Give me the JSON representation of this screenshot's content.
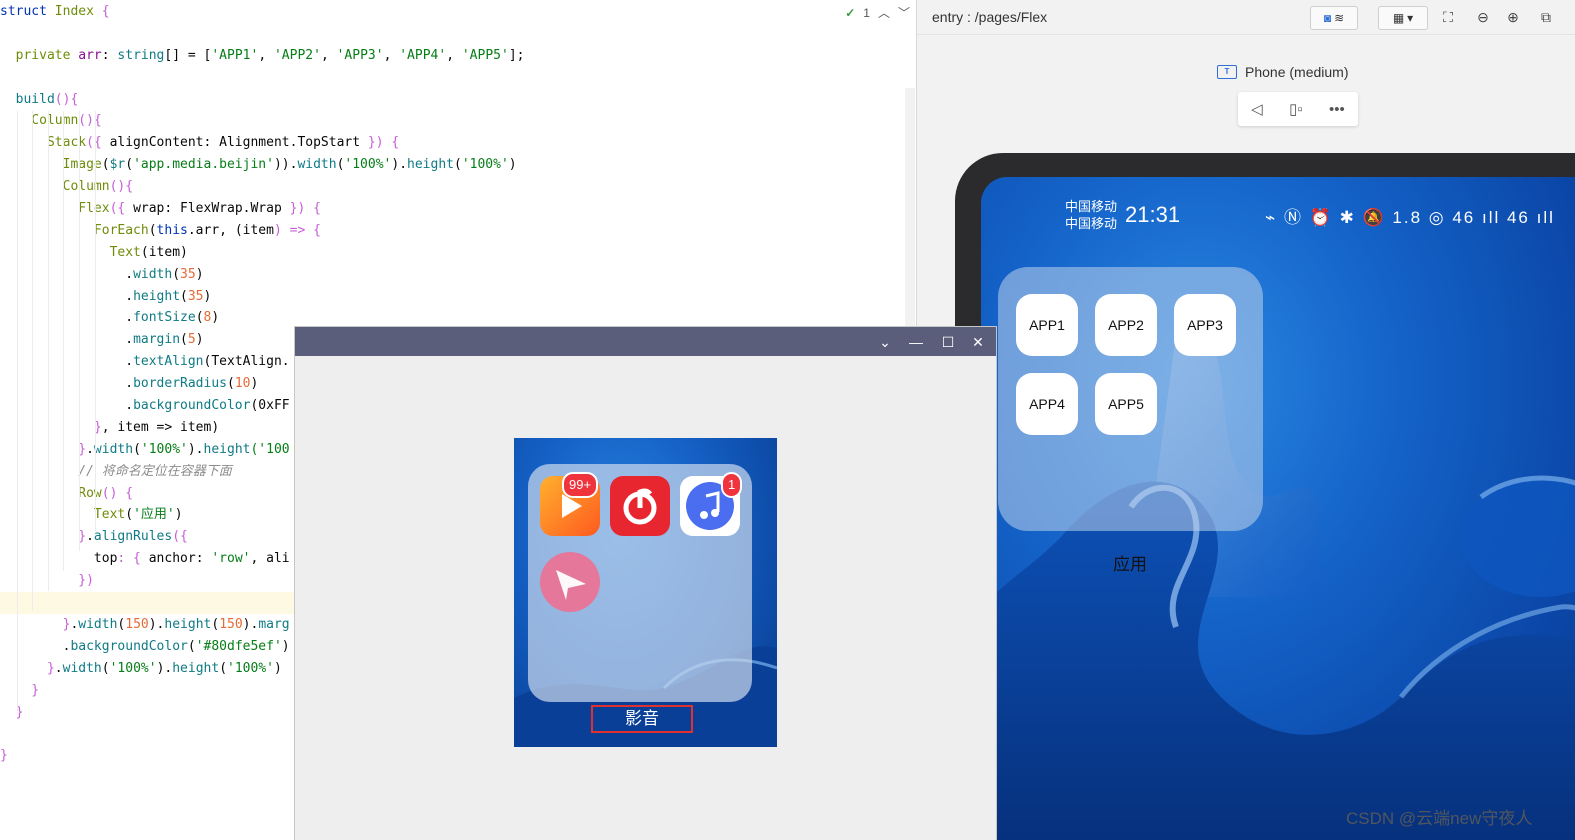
{
  "editor": {
    "inspection": {
      "count": "1"
    },
    "lines": [
      [
        {
          "t": "struct ",
          "c": "tok-kw"
        },
        {
          "t": "Index ",
          "c": "tok-olive"
        },
        {
          "t": "{",
          "c": "tok-brace"
        }
      ],
      [],
      [
        {
          "t": "  private ",
          "c": "tok-olive"
        },
        {
          "t": "arr",
          "c": "tok-prop"
        },
        {
          "t": ": ",
          "c": "tok-ident"
        },
        {
          "t": "string",
          "c": "tok-teal"
        },
        {
          "t": "[] = [",
          "c": "tok-ident"
        },
        {
          "t": "'APP1'",
          "c": "tok-str"
        },
        {
          "t": ", ",
          "c": "tok-ident"
        },
        {
          "t": "'APP2'",
          "c": "tok-str"
        },
        {
          "t": ", ",
          "c": "tok-ident"
        },
        {
          "t": "'APP3'",
          "c": "tok-str"
        },
        {
          "t": ", ",
          "c": "tok-ident"
        },
        {
          "t": "'APP4'",
          "c": "tok-str"
        },
        {
          "t": ", ",
          "c": "tok-ident"
        },
        {
          "t": "'APP5'",
          "c": "tok-str"
        },
        {
          "t": "];",
          "c": "tok-ident"
        }
      ],
      [],
      [
        {
          "t": "  build",
          "c": "tok-teal"
        },
        {
          "t": "(){",
          "c": "tok-brace"
        }
      ],
      [
        {
          "t": "    Column",
          "c": "tok-olive"
        },
        {
          "t": "(){",
          "c": "tok-brace"
        }
      ],
      [
        {
          "t": "      Stack",
          "c": "tok-olive"
        },
        {
          "t": "({ ",
          "c": "tok-brace"
        },
        {
          "t": "alignContent",
          "c": "tok-ident"
        },
        {
          "t": ": ",
          "c": "tok-ident"
        },
        {
          "t": "Alignment",
          "c": "tok-ident"
        },
        {
          "t": ".",
          "c": "tok-ident"
        },
        {
          "t": "TopStart",
          "c": "tok-ident"
        },
        {
          "t": " }) {",
          "c": "tok-brace"
        }
      ],
      [
        {
          "t": "        Image",
          "c": "tok-olive"
        },
        {
          "t": "(",
          "c": "tok-ident"
        },
        {
          "t": "$r",
          "c": "tok-teal"
        },
        {
          "t": "(",
          "c": "tok-ident"
        },
        {
          "t": "'app.media.beijin'",
          "c": "tok-str"
        },
        {
          "t": ")).",
          "c": "tok-ident"
        },
        {
          "t": "width",
          "c": "tok-teal"
        },
        {
          "t": "(",
          "c": "tok-ident"
        },
        {
          "t": "'100%'",
          "c": "tok-str"
        },
        {
          "t": ").",
          "c": "tok-ident"
        },
        {
          "t": "height",
          "c": "tok-teal"
        },
        {
          "t": "(",
          "c": "tok-ident"
        },
        {
          "t": "'100%'",
          "c": "tok-str"
        },
        {
          "t": ")",
          "c": "tok-ident"
        }
      ],
      [
        {
          "t": "        Column",
          "c": "tok-olive"
        },
        {
          "t": "(){",
          "c": "tok-brace"
        }
      ],
      [
        {
          "t": "          Flex",
          "c": "tok-olive"
        },
        {
          "t": "({ ",
          "c": "tok-brace"
        },
        {
          "t": "wrap",
          "c": "tok-ident"
        },
        {
          "t": ": ",
          "c": "tok-ident"
        },
        {
          "t": "FlexWrap",
          "c": "tok-ident"
        },
        {
          "t": ".",
          "c": "tok-ident"
        },
        {
          "t": "Wrap",
          "c": "tok-ident"
        },
        {
          "t": " }) {",
          "c": "tok-brace"
        }
      ],
      [
        {
          "t": "            ForEach",
          "c": "tok-olive"
        },
        {
          "t": "(",
          "c": "tok-ident"
        },
        {
          "t": "this",
          "c": "tok-kw"
        },
        {
          "t": ".arr, (",
          "c": "tok-ident"
        },
        {
          "t": "item",
          "c": "tok-ident"
        },
        {
          "t": ") => {",
          "c": "tok-brace"
        }
      ],
      [
        {
          "t": "              Text",
          "c": "tok-olive"
        },
        {
          "t": "(item)",
          "c": "tok-ident"
        }
      ],
      [
        {
          "t": "                .",
          "c": "tok-ident"
        },
        {
          "t": "width",
          "c": "tok-teal"
        },
        {
          "t": "(",
          "c": "tok-ident"
        },
        {
          "t": "35",
          "c": "tok-num"
        },
        {
          "t": ")",
          "c": "tok-ident"
        }
      ],
      [
        {
          "t": "                .",
          "c": "tok-ident"
        },
        {
          "t": "height",
          "c": "tok-teal"
        },
        {
          "t": "(",
          "c": "tok-ident"
        },
        {
          "t": "35",
          "c": "tok-num"
        },
        {
          "t": ")",
          "c": "tok-ident"
        }
      ],
      [
        {
          "t": "                .",
          "c": "tok-ident"
        },
        {
          "t": "fontSize",
          "c": "tok-teal"
        },
        {
          "t": "(",
          "c": "tok-ident"
        },
        {
          "t": "8",
          "c": "tok-num"
        },
        {
          "t": ")",
          "c": "tok-ident"
        }
      ],
      [
        {
          "t": "                .",
          "c": "tok-ident"
        },
        {
          "t": "margin",
          "c": "tok-teal"
        },
        {
          "t": "(",
          "c": "tok-ident"
        },
        {
          "t": "5",
          "c": "tok-num"
        },
        {
          "t": ")",
          "c": "tok-ident"
        }
      ],
      [
        {
          "t": "                .",
          "c": "tok-ident"
        },
        {
          "t": "textAlign",
          "c": "tok-teal"
        },
        {
          "t": "(TextAlign.",
          "c": "tok-ident"
        }
      ],
      [
        {
          "t": "                .",
          "c": "tok-ident"
        },
        {
          "t": "borderRadius",
          "c": "tok-teal"
        },
        {
          "t": "(",
          "c": "tok-ident"
        },
        {
          "t": "10",
          "c": "tok-num"
        },
        {
          "t": ")",
          "c": "tok-ident"
        }
      ],
      [
        {
          "t": "                .",
          "c": "tok-ident"
        },
        {
          "t": "backgroundColor",
          "c": "tok-teal"
        },
        {
          "t": "(0xFF",
          "c": "tok-ident"
        }
      ],
      [
        {
          "t": "            }",
          "c": "tok-brace"
        },
        {
          "t": ", item => item)",
          "c": "tok-ident"
        }
      ],
      [
        {
          "t": "          }",
          "c": "tok-brace"
        },
        {
          "t": ".",
          "c": "tok-ident"
        },
        {
          "t": "width",
          "c": "tok-teal"
        },
        {
          "t": "(",
          "c": "tok-ident"
        },
        {
          "t": "'100%'",
          "c": "tok-str"
        },
        {
          "t": ").",
          "c": "tok-ident"
        },
        {
          "t": "height",
          "c": "tok-teal"
        },
        {
          "t": "('100",
          "c": "tok-str"
        }
      ],
      [
        {
          "t": "          // 将命名定位在容器下面",
          "c": "tok-cmt"
        }
      ],
      [
        {
          "t": "          Row",
          "c": "tok-olive"
        },
        {
          "t": "() {",
          "c": "tok-brace"
        }
      ],
      [
        {
          "t": "            Text",
          "c": "tok-olive"
        },
        {
          "t": "(",
          "c": "tok-ident"
        },
        {
          "t": "'应用'",
          "c": "tok-str"
        },
        {
          "t": ")",
          "c": "tok-ident"
        }
      ],
      [
        {
          "t": "          }",
          "c": "tok-brace"
        },
        {
          "t": ".",
          "c": "tok-ident"
        },
        {
          "t": "alignRules",
          "c": "tok-teal"
        },
        {
          "t": "({",
          "c": "tok-brace"
        }
      ],
      [
        {
          "t": "            top",
          "c": "tok-ident"
        },
        {
          "t": ": { ",
          "c": "tok-brace"
        },
        {
          "t": "anchor",
          "c": "tok-ident"
        },
        {
          "t": ": ",
          "c": "tok-ident"
        },
        {
          "t": "'row'",
          "c": "tok-str"
        },
        {
          "t": ", ali",
          "c": "tok-ident"
        }
      ],
      [
        {
          "t": "          })",
          "c": "tok-brace"
        }
      ],
      [],
      [
        {
          "t": "        }",
          "c": "tok-brace"
        },
        {
          "t": ".",
          "c": "tok-ident"
        },
        {
          "t": "width",
          "c": "tok-teal"
        },
        {
          "t": "(",
          "c": "tok-ident"
        },
        {
          "t": "150",
          "c": "tok-num"
        },
        {
          "t": ").",
          "c": "tok-ident"
        },
        {
          "t": "height",
          "c": "tok-teal"
        },
        {
          "t": "(",
          "c": "tok-ident"
        },
        {
          "t": "150",
          "c": "tok-num"
        },
        {
          "t": ").",
          "c": "tok-ident"
        },
        {
          "t": "marg",
          "c": "tok-teal"
        }
      ],
      [
        {
          "t": "        .",
          "c": "tok-ident"
        },
        {
          "t": "backgroundColor",
          "c": "tok-teal"
        },
        {
          "t": "(",
          "c": "tok-ident"
        },
        {
          "t": "'#80dfe5ef'",
          "c": "tok-str"
        },
        {
          "t": ")",
          "c": "tok-ident"
        }
      ],
      [
        {
          "t": "      }",
          "c": "tok-brace"
        },
        {
          "t": ".",
          "c": "tok-ident"
        },
        {
          "t": "width",
          "c": "tok-teal"
        },
        {
          "t": "(",
          "c": "tok-ident"
        },
        {
          "t": "'100%'",
          "c": "tok-str"
        },
        {
          "t": ").",
          "c": "tok-ident"
        },
        {
          "t": "height",
          "c": "tok-teal"
        },
        {
          "t": "(",
          "c": "tok-ident"
        },
        {
          "t": "'100%'",
          "c": "tok-str"
        },
        {
          "t": ")",
          "c": "tok-ident"
        }
      ],
      [
        {
          "t": "    }",
          "c": "tok-brace"
        }
      ],
      [
        {
          "t": "  }",
          "c": "tok-brace"
        }
      ],
      [],
      [
        {
          "t": "}",
          "c": "tok-brace"
        }
      ]
    ],
    "highlighted_line": 27
  },
  "previewer": {
    "path": "entry : /pages/Flex",
    "device": "Phone (medium)",
    "phone": {
      "carrier1": "中国移动",
      "carrier2": "中国移动",
      "time": "21:31",
      "status_icons": "⌁ Ⓝ ⏰ ✱ 🔕 1.8 ◎ 46 ıll 46 ıll",
      "apps": [
        "APP1",
        "APP2",
        "APP3",
        "APP4",
        "APP5"
      ],
      "folder_label": "应用"
    }
  },
  "viewer": {
    "badge1": "99+",
    "badge3": "1",
    "folder_label": "影音"
  },
  "watermark": "CSDN @云端new守夜人",
  "colors": {
    "titlebar": "#5b5e7a",
    "highlight_box": "#e0312f",
    "code_string": "#067d17",
    "code_number": "#e56a35"
  }
}
